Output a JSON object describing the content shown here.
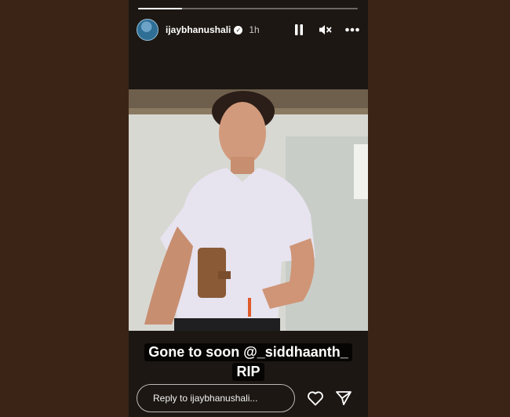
{
  "story": {
    "progress": 0.2,
    "user": {
      "username": "ijaybhanushali",
      "verified": true,
      "time_ago": "1h"
    },
    "controls": {
      "pause_icon": "pause-icon",
      "mute_icon": "muted-speaker-icon",
      "more_icon": "more-horizontal-icon"
    },
    "caption": {
      "line1": "Gone to soon @_siddhaanth_",
      "line2": "RIP"
    },
    "reply": {
      "placeholder": "Reply to ijaybhanushali..."
    },
    "actions": {
      "like_icon": "heart-icon",
      "share_icon": "send-icon"
    }
  },
  "colors": {
    "page_background": "#3b2416",
    "story_background": "#1c1712",
    "text": "#ffffff"
  }
}
